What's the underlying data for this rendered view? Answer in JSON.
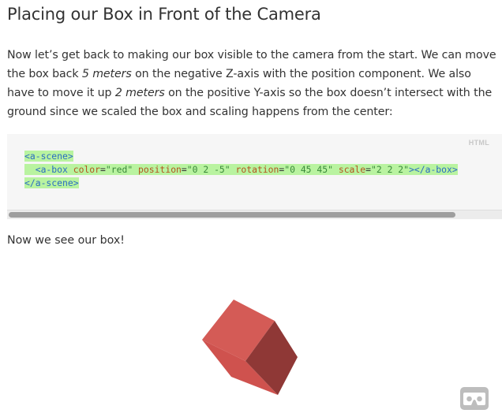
{
  "section": {
    "title": "Placing our Box in Front of the Camera",
    "intro": {
      "p1": "Now let’s get back to making our box visible to the camera from the start. We can move the box back ",
      "e1": "5 meters",
      "p2": " on the negative Z-axis with the position component. We also have to move it up ",
      "e2": "2 meters",
      "p3": " on the positive Y-axis so the box doesn’t intersect with the ground since we scaled the box and scaling happens from the center:"
    }
  },
  "code": {
    "language": "HTML",
    "line1": "<a-scene>",
    "line2": {
      "indent": "  ",
      "open": "<a-box",
      "a1": "color",
      "v1": "\"red\"",
      "a2": "position",
      "v2": "\"0 2 -5\"",
      "a3": "rotation",
      "v3": "\"0 45 45\"",
      "a4": "scale",
      "v4": "\"2 2 2\"",
      "close": "></a-box>"
    },
    "line3": "</a-scene>"
  },
  "result_text": "Now we see our box!",
  "scene": {
    "box_color": "#c9514f",
    "icon": "cardboard-vr-icon"
  }
}
